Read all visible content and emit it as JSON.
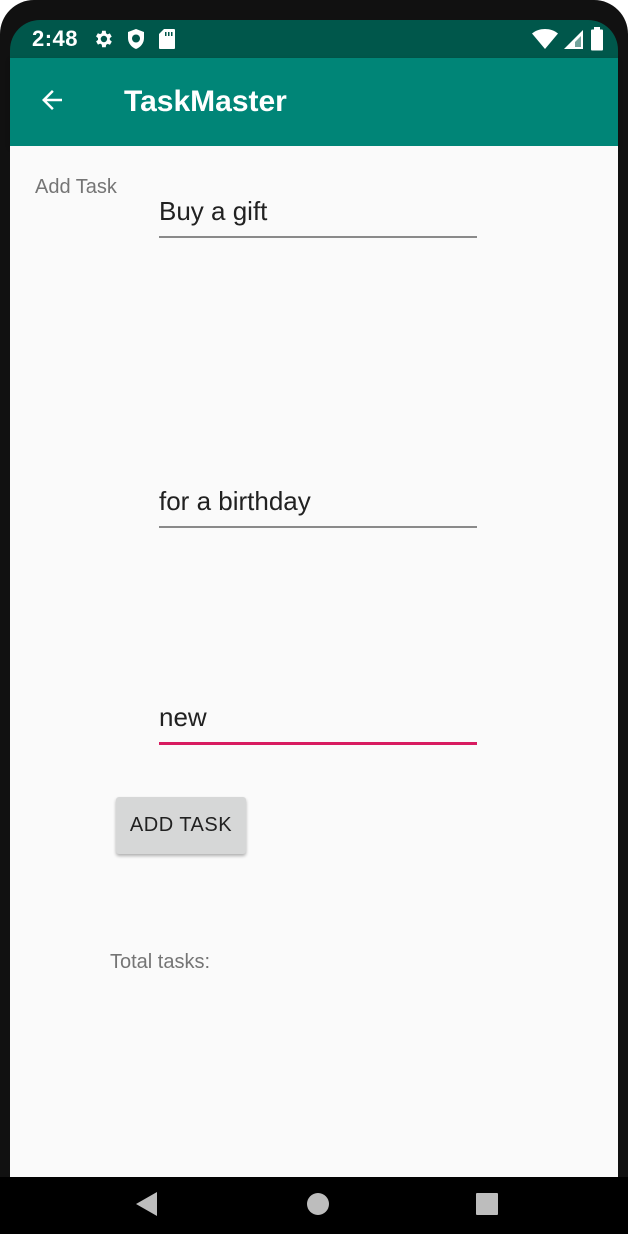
{
  "status_bar": {
    "time": "2:48",
    "icons_left": [
      "gear-icon",
      "shield-icon",
      "sd-card-icon"
    ],
    "icons_right": [
      "wifi-icon",
      "signal-icon",
      "battery-icon"
    ],
    "background": "#00574b"
  },
  "app_bar": {
    "title": "TaskMaster",
    "back_icon": "arrow-left-icon",
    "background": "#008577"
  },
  "form": {
    "section_label": "Add Task",
    "title_value": "Buy a gift",
    "description_value": "for a birthday",
    "status_value": "new",
    "submit_label": "ADD TASK",
    "accent_color": "#d81b60"
  },
  "summary": {
    "total_label": "Total tasks:"
  },
  "nav_bar": {
    "buttons": [
      "back-triangle-icon",
      "home-circle-icon",
      "recents-square-icon"
    ]
  }
}
